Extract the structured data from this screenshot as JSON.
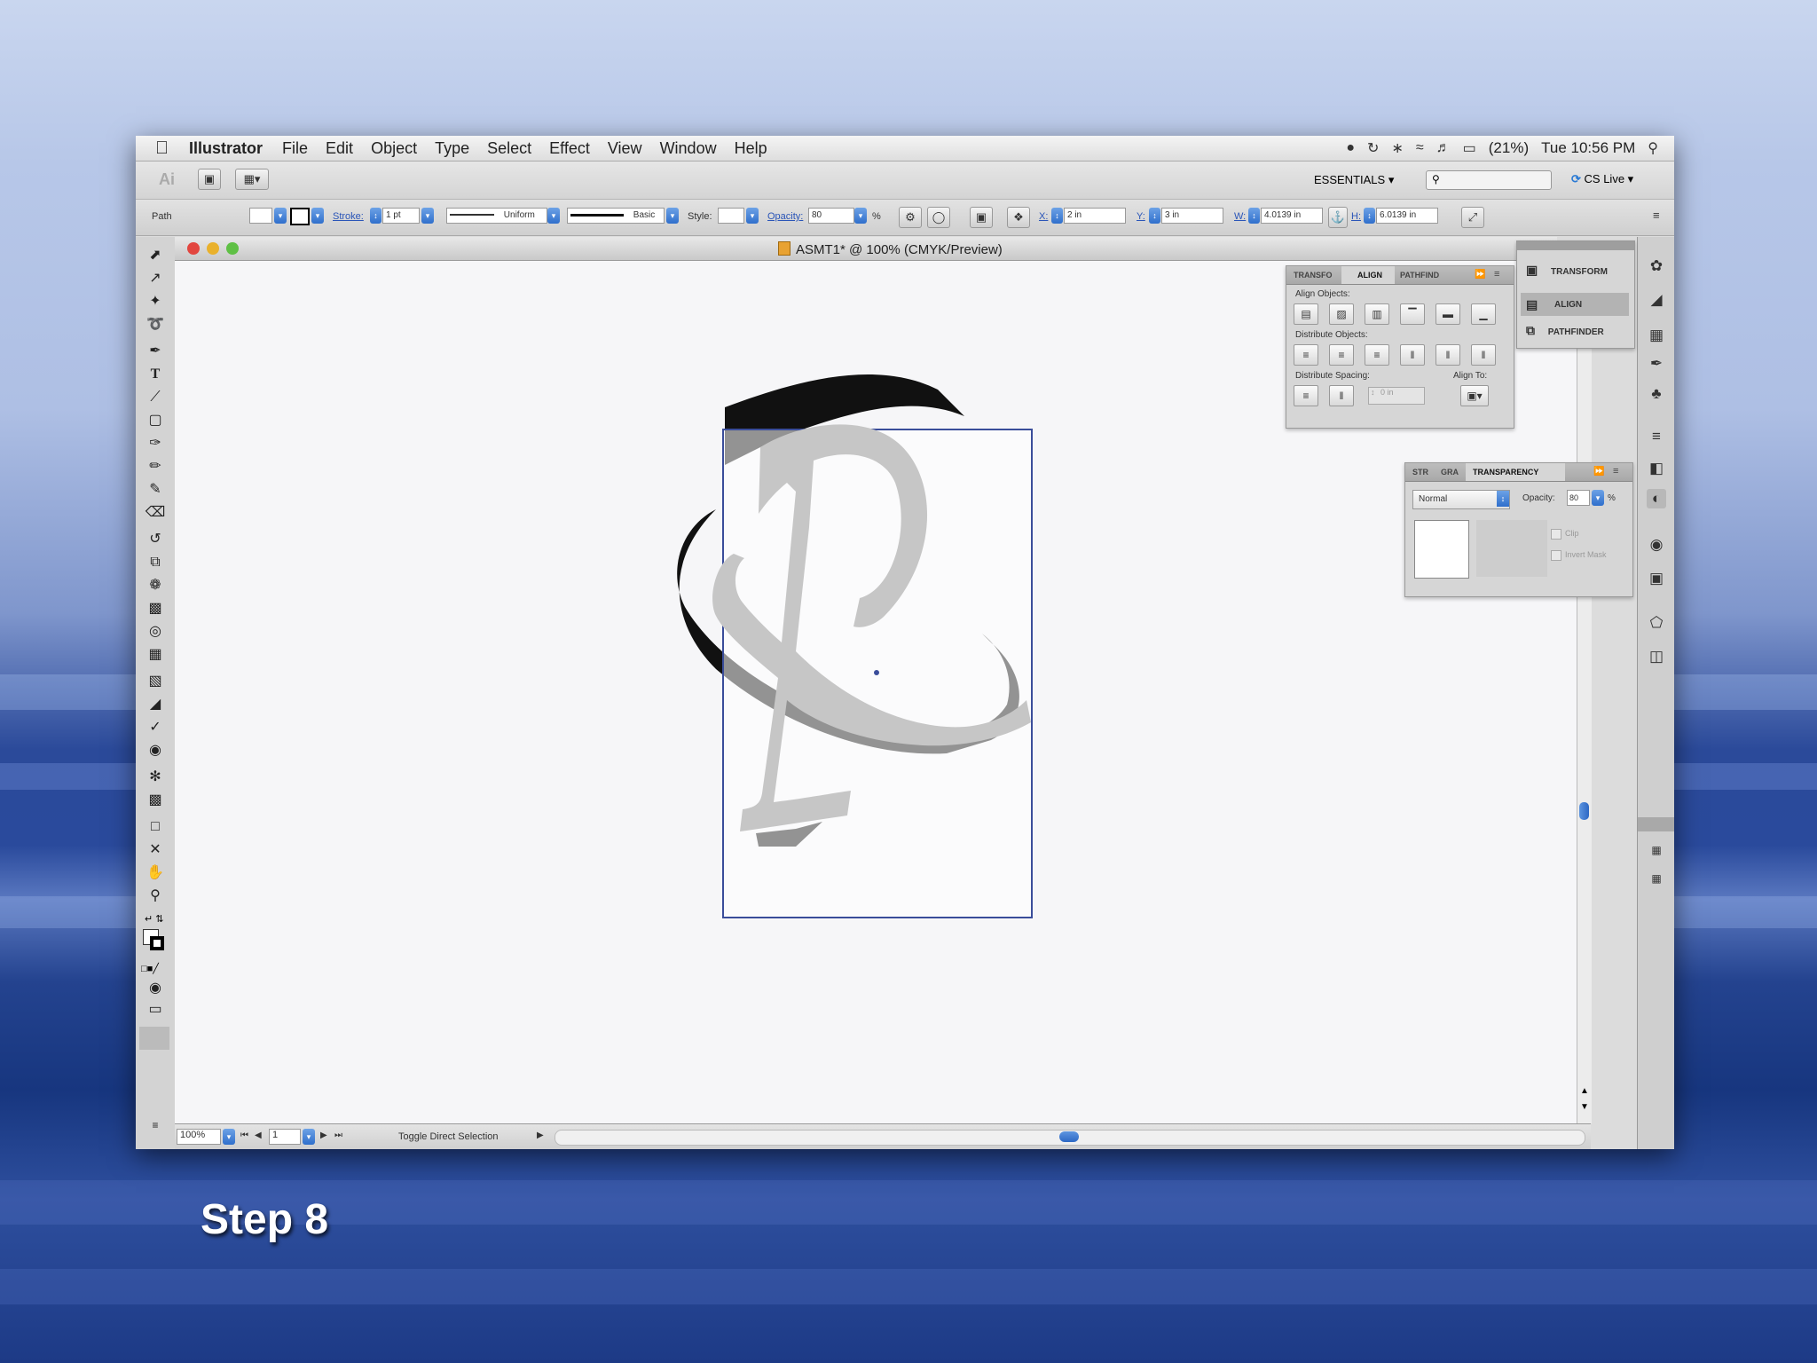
{
  "menubar": {
    "app_name": "Illustrator",
    "items": [
      "File",
      "Edit",
      "Object",
      "Type",
      "Select",
      "Effect",
      "View",
      "Window",
      "Help"
    ],
    "battery": "(21%)",
    "clock": "Tue 10:56 PM"
  },
  "appbar": {
    "workspace": "ESSENTIALS",
    "cs_live": "CS Live"
  },
  "controlbar": {
    "selection_type": "Path",
    "stroke_label": "Stroke:",
    "stroke_value": "1 pt",
    "profile_label": "Uniform",
    "brush_label": "Basic",
    "style_label": "Style:",
    "opacity_label": "Opacity:",
    "opacity_value": "80",
    "opacity_unit": "%",
    "x_label": "X:",
    "x_value": "2 in",
    "y_label": "Y:",
    "y_value": "3 in",
    "w_label": "W:",
    "w_value": "4.0139 in",
    "h_label": "H:",
    "h_value": "6.0139 in"
  },
  "document": {
    "title": "ASMT1* @ 100% (CMYK/Preview)"
  },
  "align_panel": {
    "tabs": [
      "TRANSFO",
      "ALIGN",
      "PATHFIND"
    ],
    "align_objects": "Align Objects:",
    "distribute_objects": "Distribute Objects:",
    "distribute_spacing": "Distribute Spacing:",
    "align_to": "Align To:",
    "spacing_value": "0 in"
  },
  "collapsed_dock": {
    "items": [
      "TRANSFORM",
      "ALIGN",
      "PATHFINDER"
    ]
  },
  "transparency_panel": {
    "tabs": [
      "STR",
      "GRA",
      "TRANSPARENCY"
    ],
    "blend_mode": "Normal",
    "opacity_label": "Opacity:",
    "opacity_value": "80",
    "opacity_unit": "%",
    "clip_label": "Clip",
    "invert_label": "Invert Mask"
  },
  "statusbar": {
    "zoom": "100%",
    "page": "1",
    "status_text": "Toggle Direct Selection"
  },
  "slide": {
    "caption": "Step 8"
  }
}
